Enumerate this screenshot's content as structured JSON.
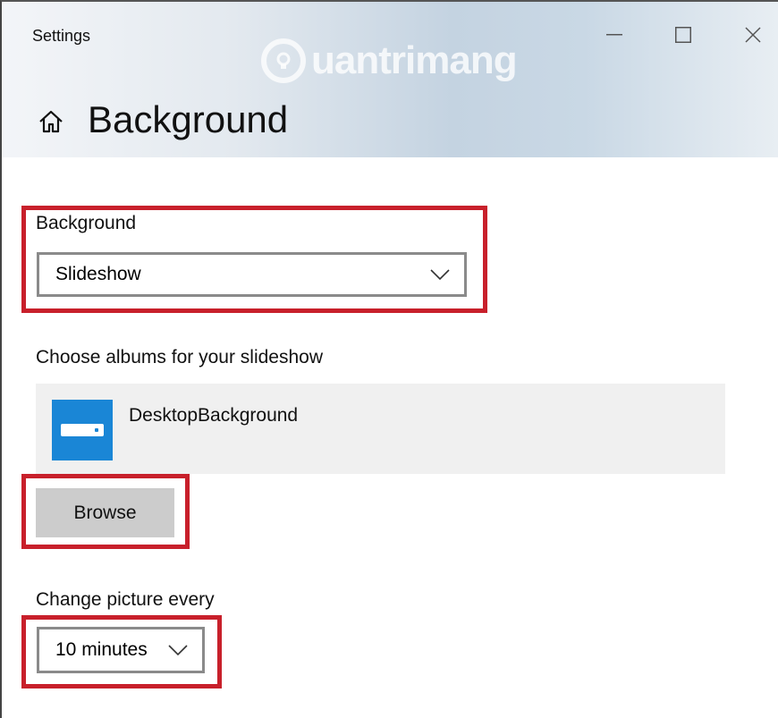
{
  "window": {
    "app_title": "Settings",
    "watermark_text": "uantrimang",
    "controls": {
      "minimize_icon": "minimize-icon",
      "maximize_icon": "maximize-icon",
      "close_icon": "close-icon"
    }
  },
  "page": {
    "title": "Background",
    "home_icon": "home-icon"
  },
  "background_section": {
    "label": "Background",
    "selected": "Slideshow"
  },
  "albums_section": {
    "label": "Choose albums for your slideshow",
    "album_name": "DesktopBackground",
    "album_icon": "folder-drive-icon",
    "browse_label": "Browse"
  },
  "interval_section": {
    "label": "Change picture every",
    "selected": "10 minutes"
  },
  "colors": {
    "highlight": "#c8202b",
    "album_tile": "#1a86d6",
    "button_bg": "#cccccc"
  }
}
